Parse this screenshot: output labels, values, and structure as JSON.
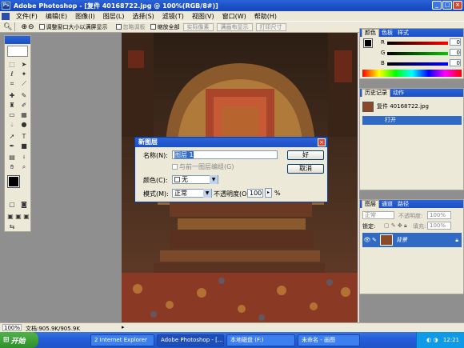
{
  "app": {
    "title": "Adobe Photoshop - [复件 40168722.jpg @ 100%(RGB/8#)]",
    "minimize": "_",
    "maximize": "□",
    "close": "×"
  },
  "menu": [
    "文件(F)",
    "编辑(E)",
    "图像(I)",
    "图层(L)",
    "选择(S)",
    "滤镜(T)",
    "视图(V)",
    "窗口(W)",
    "帮助(H)"
  ],
  "options": {
    "zoom_in": "⊕",
    "zoom_out": "⊖",
    "resize_label": "调整窗口大小以满屏显示",
    "ignore_palettes": "忽略调板",
    "zoom_all": "缩放全部",
    "actual_pixels": "实际像素",
    "fit_screen": "满画布显示",
    "print_size": "打印尺寸"
  },
  "color_panel": {
    "tabs": [
      "颜色",
      "色板",
      "样式"
    ],
    "r_label": "R",
    "g_label": "G",
    "b_label": "B",
    "r": "0",
    "g": "0",
    "b": "0"
  },
  "history_panel": {
    "tabs": [
      "历史记录",
      "动作"
    ],
    "snapshot": "复件 40168722.jpg",
    "item": "打开"
  },
  "layers_panel": {
    "tabs": [
      "图层",
      "通道",
      "路径"
    ],
    "blend_mode": "正常",
    "opacity_label": "不透明度:",
    "opacity": "100%",
    "lock_label": "锁定:",
    "fill_label": "填充:",
    "fill": "100%",
    "layer_name": "背景"
  },
  "dialog": {
    "title": "新图层",
    "name_label": "名称(N):",
    "name_value": "图层 1",
    "clip_label": "与前一图层编组(G)",
    "color_label": "颜色(C):",
    "color_value": "无",
    "mode_label": "模式(M):",
    "mode_value": "正常",
    "opacity_label": "不透明度(O):",
    "opacity_value": "100",
    "percent": "%",
    "ok": "好",
    "cancel": "取消"
  },
  "status": {
    "zoom": "100%",
    "doc": "文档:905.9K/905.9K"
  },
  "taskbar": {
    "start": "开始",
    "items": [
      "2 Internet Explorer",
      "Adobe Photoshop - [...",
      "本地磁盘 (F:)",
      "未命名 - 画图"
    ],
    "time": "12:21"
  }
}
